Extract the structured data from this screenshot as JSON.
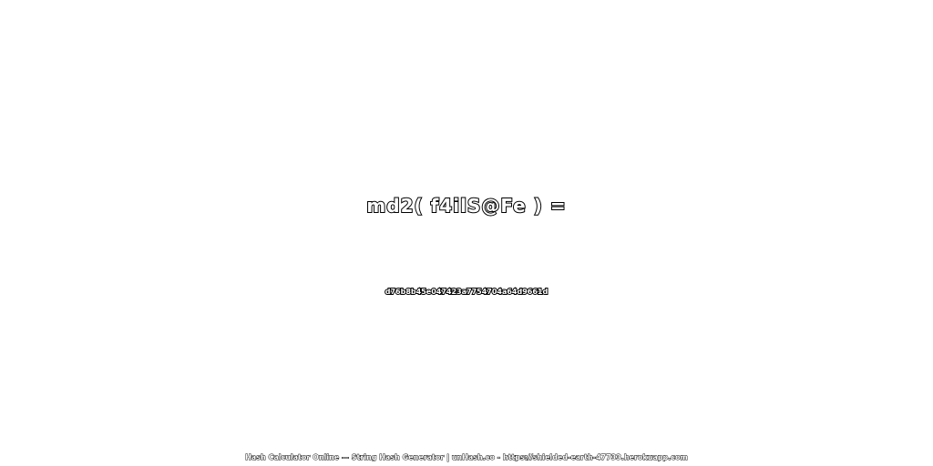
{
  "expression": "md2( f4ilS@Fe ) =",
  "hash": "d76b8b45e047423a7754704a64d9661d",
  "footer": "Hash Calculator Online — String Hash Generator | unHash.co - https://shielded-earth-47733.herokuapp.com",
  "colors": {
    "background": "#ffffff",
    "text_fill": "#ffffff",
    "text_outline": "#000000"
  }
}
